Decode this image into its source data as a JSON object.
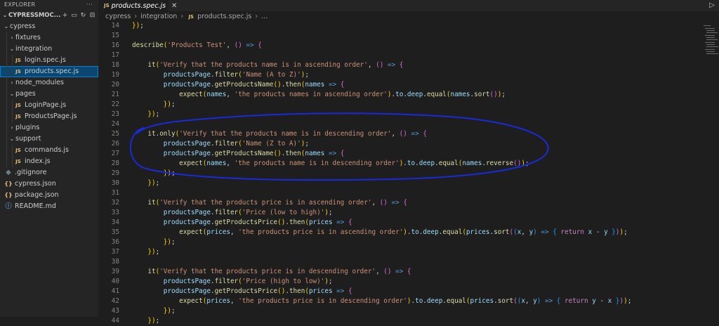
{
  "sidebar": {
    "header": "EXPLORER",
    "header_menu": "···",
    "project": "CYPRESSMOC...",
    "items": [
      {
        "label": "cypress",
        "type": "folder",
        "open": true,
        "depth": 0
      },
      {
        "label": "fixtures",
        "type": "folder",
        "open": false,
        "depth": 1
      },
      {
        "label": "integration",
        "type": "folder",
        "open": true,
        "depth": 1
      },
      {
        "label": "login.spec.js",
        "type": "js",
        "depth": 2
      },
      {
        "label": "products.spec.js",
        "type": "js",
        "depth": 2,
        "selected": true
      },
      {
        "label": "node_modules",
        "type": "folder",
        "open": false,
        "depth": 1
      },
      {
        "label": "pages",
        "type": "folder",
        "open": true,
        "depth": 1
      },
      {
        "label": "LoginPage.js",
        "type": "js",
        "depth": 2
      },
      {
        "label": "ProductsPage.js",
        "type": "js",
        "depth": 2
      },
      {
        "label": "plugins",
        "type": "folder",
        "open": false,
        "depth": 1
      },
      {
        "label": "support",
        "type": "folder",
        "open": true,
        "depth": 1
      },
      {
        "label": "commands.js",
        "type": "js",
        "depth": 2
      },
      {
        "label": "index.js",
        "type": "js",
        "depth": 2
      },
      {
        "label": ".gitignore",
        "type": "git",
        "depth": 0
      },
      {
        "label": "cypress.json",
        "type": "json",
        "depth": 0
      },
      {
        "label": "package.json",
        "type": "json",
        "depth": 0
      },
      {
        "label": "README.md",
        "type": "md",
        "depth": 0
      }
    ]
  },
  "tab": {
    "label": "products.spec.js",
    "icon": "JS",
    "close": "✕"
  },
  "breadcrumb": {
    "parts": [
      "cypress",
      "integration"
    ],
    "file": "products.spec.js",
    "tail": "..."
  },
  "icons": {
    "js": "JS",
    "json": "{}",
    "git": "◆",
    "md": "ⓘ",
    "chevron_open": "⌄",
    "chevron_closed": "›",
    "new_file": "🗋",
    "new_folder": "🗀",
    "refresh": "↻",
    "collapse": "⊟",
    "run": "▷"
  },
  "code": {
    "lines": [
      {
        "n": "14",
        "text": "});"
      },
      {
        "n": "15",
        "text": ""
      },
      {
        "n": "16",
        "text": "describe('Products Test', () => {"
      },
      {
        "n": "17",
        "text": ""
      },
      {
        "n": "18",
        "text": "    it('Verify that the products name is in ascending order', () => {"
      },
      {
        "n": "19",
        "text": "        productsPage.filter('Name (A to Z)');"
      },
      {
        "n": "20",
        "text": "        productsPage.getProductsName().then(names => {"
      },
      {
        "n": "21",
        "text": "            expect(names, 'the products names in ascending order').to.deep.equal(names.sort());"
      },
      {
        "n": "22",
        "text": "        });"
      },
      {
        "n": "23",
        "text": "    });"
      },
      {
        "n": "24",
        "text": ""
      },
      {
        "n": "25",
        "text": "    it.only('Verify that the products name is in descending order', () => {"
      },
      {
        "n": "26",
        "text": "        productsPage.filter('Name (Z to A)');"
      },
      {
        "n": "27",
        "text": "        productsPage.getProductsName().then(names => {"
      },
      {
        "n": "28",
        "text": "            expect(names, 'the products name is in descending order').to.deep.equal(names.reverse());"
      },
      {
        "n": "29",
        "text": "        });"
      },
      {
        "n": "30",
        "text": "    });"
      },
      {
        "n": "31",
        "text": ""
      },
      {
        "n": "32",
        "text": "    it('Verify that the products price is in ascending order', () => {"
      },
      {
        "n": "33",
        "text": "        productsPage.filter('Price (low to high)');"
      },
      {
        "n": "34",
        "text": "        productsPage.getProductsPrice().then(prices => {"
      },
      {
        "n": "35",
        "text": "            expect(prices, 'the products price is in ascending order').to.deep.equal(prices.sort((x, y) => { return x - y }));"
      },
      {
        "n": "36",
        "text": "        });"
      },
      {
        "n": "37",
        "text": "    });"
      },
      {
        "n": "38",
        "text": ""
      },
      {
        "n": "39",
        "text": "    it('Verify that the products price is in descending order', () => {"
      },
      {
        "n": "40",
        "text": "        productsPage.filter('Price (high to low)');"
      },
      {
        "n": "41",
        "text": "        productsPage.getProductsPrice().then(prices => {"
      },
      {
        "n": "42",
        "text": "            expect(prices, 'the products price is in descending order').to.deep.equal(prices.sort((x, y) => { return y - x }));"
      },
      {
        "n": "43",
        "text": "        });"
      },
      {
        "n": "44",
        "text": "    });"
      }
    ]
  },
  "colors": {
    "annotation": "#1a2ad8",
    "selection": "#094771",
    "background": "#1e1e1e",
    "sidebar": "#252526"
  }
}
